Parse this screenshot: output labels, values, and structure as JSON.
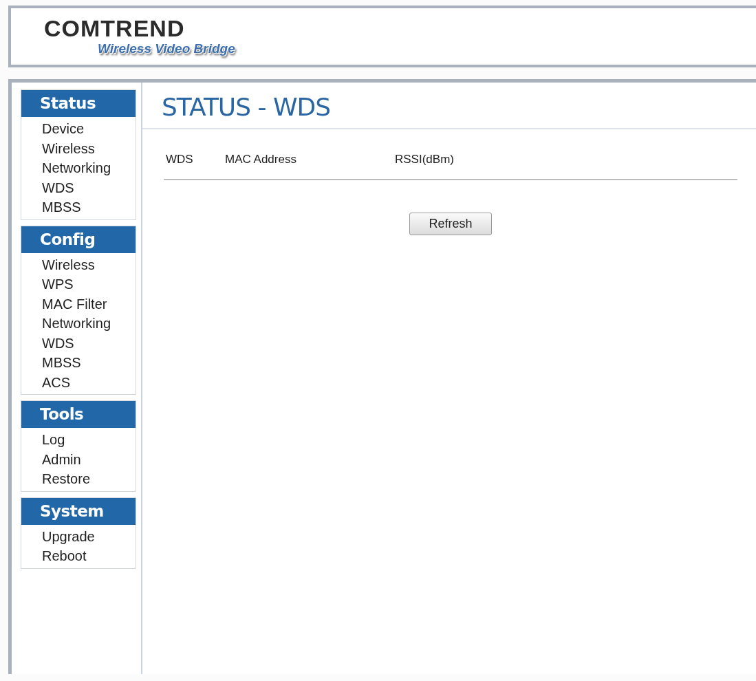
{
  "header": {
    "brand": "COMTREND",
    "product": "Wireless Video Bridge"
  },
  "sidebar": {
    "sections": [
      {
        "title": "Status",
        "items": [
          "Device",
          "Wireless",
          "Networking",
          "WDS",
          "MBSS"
        ]
      },
      {
        "title": "Config",
        "items": [
          "Wireless",
          "WPS",
          "MAC Filter",
          "Networking",
          "WDS",
          "MBSS",
          "ACS"
        ]
      },
      {
        "title": "Tools",
        "items": [
          "Log",
          "Admin",
          "Restore"
        ]
      },
      {
        "title": "System",
        "items": [
          "Upgrade",
          "Reboot"
        ]
      }
    ]
  },
  "page": {
    "title": "STATUS - WDS",
    "table": {
      "columns": [
        "WDS",
        "MAC Address",
        "RSSI(dBm)"
      ]
    },
    "buttons": [
      "Refresh"
    ]
  }
}
